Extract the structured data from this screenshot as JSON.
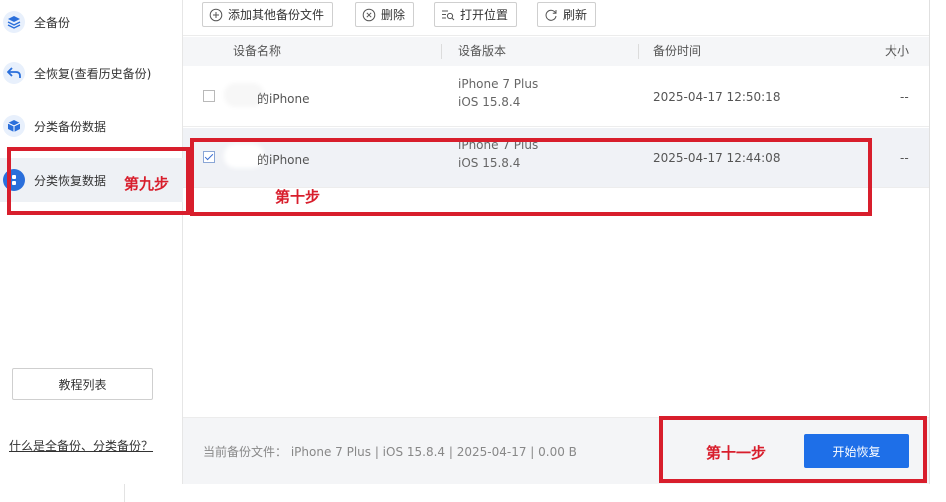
{
  "sidebar": {
    "items": [
      {
        "label": "全备份",
        "icon": "layers-icon"
      },
      {
        "label": "全恢复(查看历史备份)",
        "icon": "undo-arrow-icon"
      },
      {
        "label": "分类备份数据",
        "icon": "cube-icon"
      },
      {
        "label": "分类恢复数据",
        "icon": "category-restore-icon"
      }
    ],
    "tutorial_label": "教程列表",
    "help_link": "什么是全备份、分类备份？"
  },
  "toolbar": {
    "add_label": "添加其他备份文件",
    "delete_label": "删除",
    "open_label": "打开位置",
    "refresh_label": "刷新"
  },
  "table": {
    "columns": [
      "设备名称",
      "设备版本",
      "备份时间",
      "大小"
    ],
    "rows": [
      {
        "checked": false,
        "name": "的iPhone",
        "model": "iPhone 7 Plus",
        "os": "iOS 15.8.4",
        "time": "2025-04-17 12:50:18",
        "size": "--"
      },
      {
        "checked": true,
        "name": "的iPhone",
        "model": "iPhone 7 Plus",
        "os": "iOS 15.8.4",
        "time": "2025-04-17 12:44:08",
        "size": "--"
      }
    ]
  },
  "footer": {
    "current_info": "当前备份文件： iPhone 7 Plus | iOS 15.8.4 | 2025-04-17 | 0.00 B",
    "start_label": "开始恢复"
  },
  "annotations": {
    "step9": "第九步",
    "step10": "第十步",
    "step11": "第十一步"
  },
  "colors": {
    "accent": "#1e6fe8",
    "annotation": "#d81e2c"
  }
}
